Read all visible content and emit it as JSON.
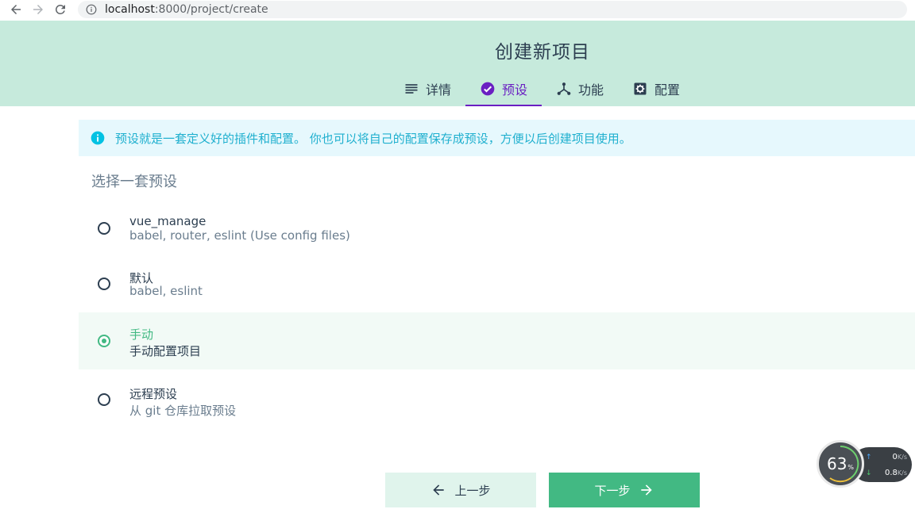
{
  "browser": {
    "url_host": "localhost",
    "url_path": ":8000/project/create"
  },
  "header": {
    "title": "创建新项目",
    "tabs": [
      {
        "label": "详情",
        "icon": "list-icon",
        "active": false
      },
      {
        "label": "预设",
        "icon": "check-circle-icon",
        "active": true
      },
      {
        "label": "功能",
        "icon": "fork-icon",
        "active": false
      },
      {
        "label": "配置",
        "icon": "gear-icon",
        "active": false
      }
    ]
  },
  "info": {
    "text": "预设就是一套定义好的插件和配置。 你也可以将自己的配置保存成预设，方便以后创建项目使用。"
  },
  "section_label": "选择一套预设",
  "presets": [
    {
      "name": "vue_manage",
      "desc": "babel, router, eslint (Use config files)",
      "selected": false
    },
    {
      "name": "默认",
      "desc": "babel, eslint",
      "selected": false
    },
    {
      "name": "手动",
      "desc": "手动配置项目",
      "selected": true
    },
    {
      "name": "远程预设",
      "desc": "从 git 仓库拉取预设",
      "selected": false
    }
  ],
  "buttons": {
    "prev": "上一步",
    "next": "下一步"
  },
  "speed_widget": {
    "cpu_value": "63",
    "cpu_unit": "%",
    "upload_value": "0",
    "upload_unit": "K/s",
    "download_value": "0.8",
    "download_unit": "K/s"
  },
  "colors": {
    "header_bg": "#c6eadc",
    "accent_purple": "#6a1fc2",
    "accent_green": "#42b983",
    "info_cyan": "#20b0cf"
  }
}
